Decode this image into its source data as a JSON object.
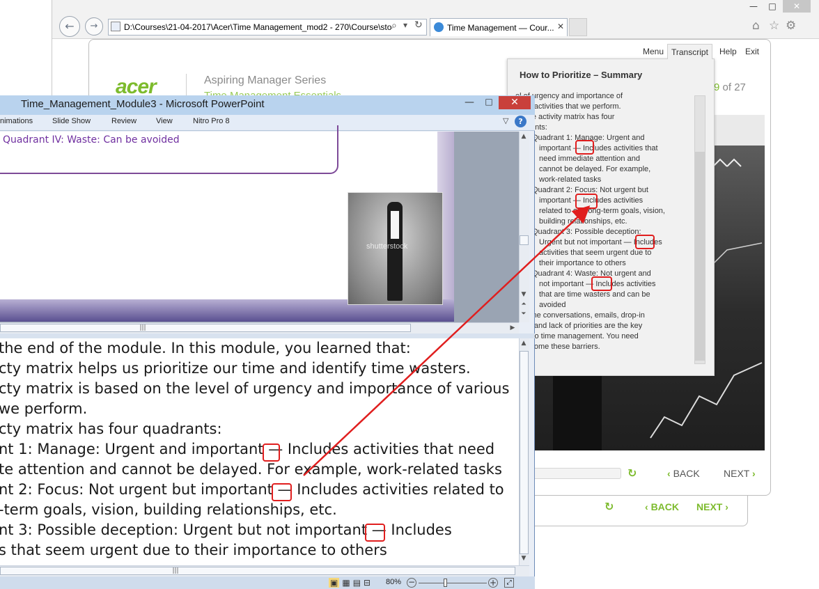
{
  "browser": {
    "address": "D:\\Courses\\21-04-2017\\Acer\\Time Management_mod2 - 270\\Course\\sto",
    "tab_title": "Time Management — Cour...",
    "minimize": "—",
    "maximize": "□",
    "close": "✕",
    "back_glyph": "←",
    "forward_glyph": "→",
    "tab_close": "✕",
    "home_icon": "⌂",
    "fav_icon": "☆",
    "settings_icon": "⚙",
    "search_glyph": "⌕",
    "dropdown_glyph": "▾",
    "refresh_glyph": "↻"
  },
  "course": {
    "logo": "acer",
    "series": "Aspiring Manager Series",
    "subtitle": "Time Management Essentials",
    "page_current": "9",
    "page_of": " of 27",
    "menu": [
      "Menu",
      "Transcript",
      "Help",
      "Exit"
    ],
    "back": "BACK",
    "next": "NEXT",
    "back_arrow": "‹",
    "next_arrow": "›",
    "refresh_icon": "↻"
  },
  "transcript": {
    "title": "How to Prioritize – Summary",
    "lines": [
      {
        "t": "el of urgency and importance of",
        "k": "p"
      },
      {
        "t": "rious activities that we perform.",
        "k": "p"
      },
      {
        "t": "e time activity matrix has four",
        "k": "p"
      },
      {
        "t": "uadrants:",
        "k": "p"
      },
      {
        "t": "Quadrant 1: Manage: Urgent and",
        "k": "b"
      },
      {
        "t": "important — Includes activities that",
        "k": "i"
      },
      {
        "t": "need immediate attention and",
        "k": "i"
      },
      {
        "t": "cannot be delayed. For example,",
        "k": "i"
      },
      {
        "t": "work-related tasks",
        "k": "i"
      },
      {
        "t": "Quadrant 2: Focus: Not urgent but",
        "k": "b"
      },
      {
        "t": "important — Includes activities",
        "k": "i"
      },
      {
        "t": "related to our long-term goals, vision,",
        "k": "i"
      },
      {
        "t": "building relationships, etc.",
        "k": "i"
      },
      {
        "t": "Quadrant 3: Possible deception:",
        "k": "b"
      },
      {
        "t": "Urgent but not important — Includes",
        "k": "i"
      },
      {
        "t": "activities that seem urgent due to",
        "k": "i"
      },
      {
        "t": "their importance to others",
        "k": "i"
      },
      {
        "t": "Quadrant 4: Waste: Not urgent and",
        "k": "b"
      },
      {
        "t": "not important — Includes activities",
        "k": "i"
      },
      {
        "t": "that are time wasters and can be",
        "k": "i"
      },
      {
        "t": "avoided",
        "k": "i"
      },
      {
        "t": "ephone conversations, emails, drop-in",
        "k": "p"
      },
      {
        "t": "itors, and lack of priorities are the key",
        "k": "p"
      },
      {
        "t": "riers to time management. You need",
        "k": "p"
      },
      {
        "t": "overcome these barriers.",
        "k": "p"
      }
    ]
  },
  "ppt": {
    "title": "Time_Management_Module3  -  Microsoft PowerPoint",
    "ribbon_tabs": [
      "nimations",
      "Slide Show",
      "Review",
      "View",
      "Nitro Pro 8"
    ],
    "slide_text": "Quadrant IV: Waste: Can be avoided",
    "photo_watermark": "shutterstock",
    "notes": [
      " the end of the module. In this module, you learned that:",
      "cty matrix helps us prioritize our time and identify time wasters.",
      "cty matrix is based on the level of urgency and importance of various",
      "we perform.",
      "cty matrix has four quadrants:",
      "nt 1: Manage: Urgent and important — Includes activities that need",
      "te attention and cannot be delayed. For example, work-related tasks",
      "nt 2: Focus: Not urgent but important — Includes activities related to",
      "-term goals, vision, building relationships, etc.",
      "nt 3: Possible deception: Urgent but not important — Includes",
      "s that seem urgent due to their importance to others"
    ],
    "zoom": "80%",
    "minimize": "—",
    "maximize": "□",
    "close": "✕",
    "help": "?",
    "collapse": "▽",
    "zoom_out": "−",
    "zoom_in": "+",
    "scroll_up": "▲",
    "scroll_down": "▼",
    "scroll_left": "◀",
    "scroll_right": "▶",
    "prev_slide": "⏶",
    "next_slide": "⏷",
    "grip": "|||",
    "view_icons": [
      "▣",
      "▦",
      "▤",
      "⊟"
    ]
  },
  "colors": {
    "accent_green": "#7dbb2d",
    "highlight_red": "#e01e1e",
    "slide_purple": "#7030a0"
  }
}
